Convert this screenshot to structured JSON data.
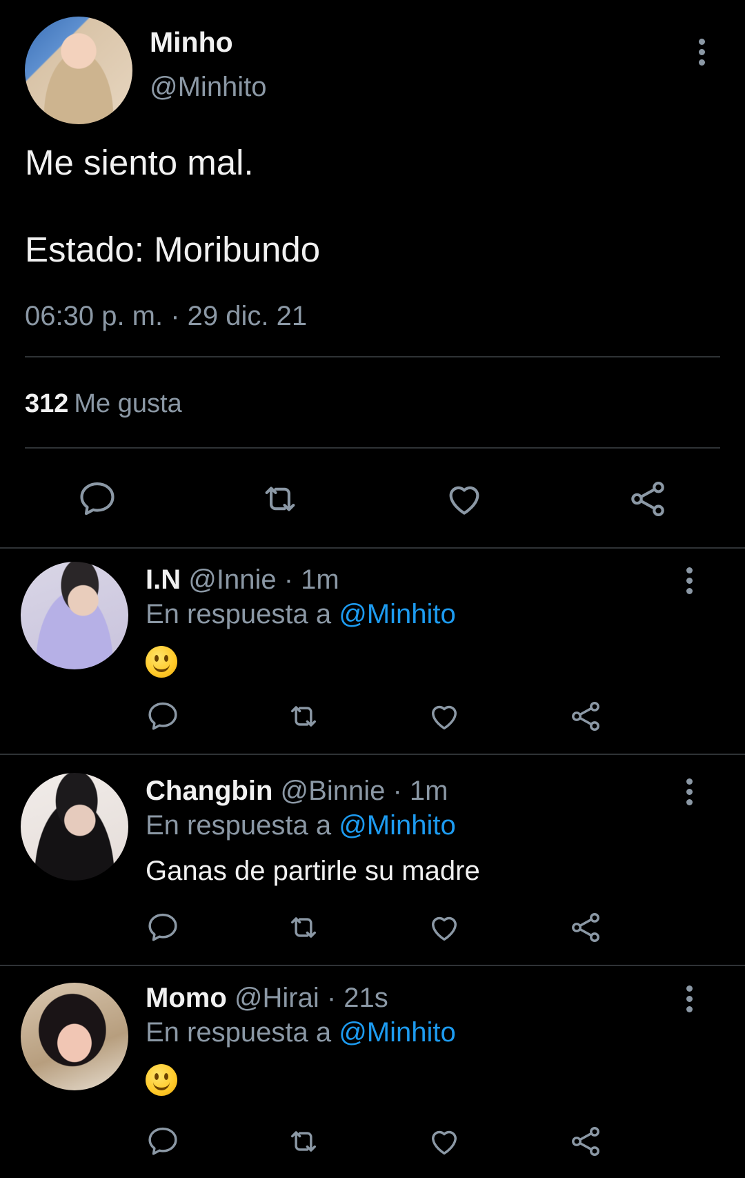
{
  "main_tweet": {
    "author_name": "Minho",
    "author_handle": "@Minhito",
    "text_line1": "Me siento mal.",
    "text_line2": "Estado: Moribundo",
    "timestamp": "06:30 p. m. · 29 dic. 21",
    "likes_count": "312",
    "likes_label": "Me gusta"
  },
  "replies": [
    {
      "name": "I.N",
      "meta": "@Innie · 1m",
      "reply_prefix": "En respuesta a",
      "mention": "@Minhito",
      "body_emoji": "slightly-smiling-face"
    },
    {
      "name": "Changbin",
      "meta": "@Binnie · 1m",
      "reply_prefix": "En respuesta a",
      "mention": "@Minhito",
      "body": "Ganas de partirle su madre"
    },
    {
      "name": "Momo",
      "meta": "@Hirai · 21s",
      "reply_prefix": "En respuesta a",
      "mention": "@Minhito",
      "body_emoji": "slightly-smiling-face"
    }
  ],
  "icons": [
    "comment-icon",
    "retweet-icon",
    "like-icon",
    "share-icon",
    "more-options-icon"
  ],
  "colors": {
    "background": "#000000",
    "text": "#e7e9ea",
    "muted": "#8b98a5",
    "link": "#1d9bf0",
    "divider": "#2f3336"
  }
}
